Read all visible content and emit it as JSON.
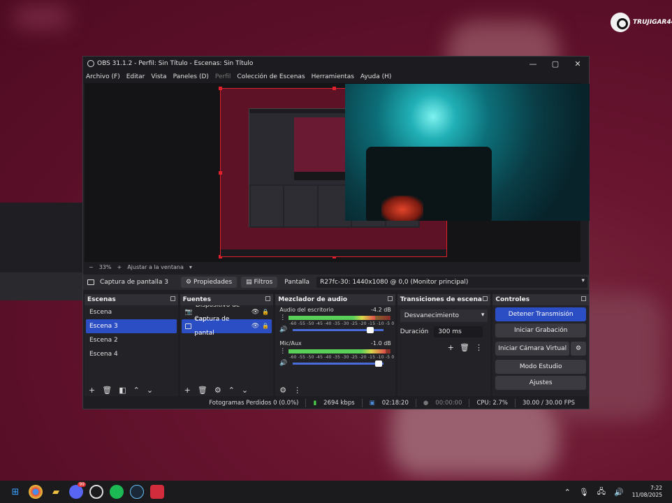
{
  "branding": {
    "overlay_text": "TRUJIGAR44"
  },
  "window": {
    "title": "OBS 31.1.2 - Perfil: Sin Título - Escenas: Sin Título",
    "controls": [
      "—",
      "▢",
      "✕"
    ]
  },
  "menu": {
    "items": [
      "Archivo (F)",
      "Editar",
      "Vista",
      "Paneles (D)",
      "Perfil",
      "Colección de Escenas",
      "Herramientas",
      "Ayuda (H)"
    ]
  },
  "zoom": {
    "minus": "−",
    "value": "33%",
    "plus": "+",
    "mode": "Ajustar a la ventana",
    "chevron": "▾"
  },
  "source_bar": {
    "selected_source": "Captura de pantalla 3",
    "properties_label": "Propiedades",
    "filters_label": "Filtros",
    "display_label": "Pantalla",
    "display_value": "R27fc-30: 1440x1080 @ 0,0 (Monitor principal)"
  },
  "scenes": {
    "title": "Escenas",
    "items": [
      "Escena",
      "Escena 3",
      "Escena 2",
      "Escena 4"
    ],
    "selected_index": 1
  },
  "sources": {
    "title": "Fuentes",
    "items": [
      {
        "label": "Dispositivo de cap",
        "icon": "camera-icon"
      },
      {
        "label": "Captura de pantal",
        "icon": "monitor-icon"
      }
    ],
    "selected_index": 1
  },
  "mixer": {
    "title": "Mezclador de audio",
    "channels": [
      {
        "name": "Audio del escritorio",
        "db": "-4.2 dB",
        "level": 0.85,
        "volume": 0.88
      },
      {
        "name": "Mic/Aux",
        "db": "-1.0 dB",
        "level": 0.95,
        "volume": 0.98
      }
    ],
    "ticks": "-60 -55 -50 -45 -40 -35 -30 -25 -20 -15 -10 -5 0"
  },
  "transitions": {
    "title": "Transiciones de escena",
    "selected": "Desvanecimiento",
    "duration_label": "Duración",
    "duration_value": "300 ms"
  },
  "controls": {
    "title": "Controles",
    "stop_stream": "Detener Transmisión",
    "start_recording": "Iniciar Grabación",
    "virtual_camera": "Iniciar Cámara Virtual",
    "studio_mode": "Modo Estudio",
    "settings": "Ajustes"
  },
  "status": {
    "dropped_frames": "Fotogramas Perdidos 0 (0.0%)",
    "bitrate": "2694 kbps",
    "stream_time": "02:18:20",
    "record_time": "00:00:00",
    "cpu": "CPU: 2.7%",
    "fps": "30.00 / 30.00 FPS"
  },
  "taskbar": {
    "apps": [
      "start-icon",
      "chrome-icon",
      "folder-icon",
      "discord-icon",
      "obs-icon",
      "spotify-icon",
      "steam-icon",
      "app-icon"
    ],
    "discord_badge": "99",
    "time": "7:22",
    "date": "11/08/2025"
  }
}
